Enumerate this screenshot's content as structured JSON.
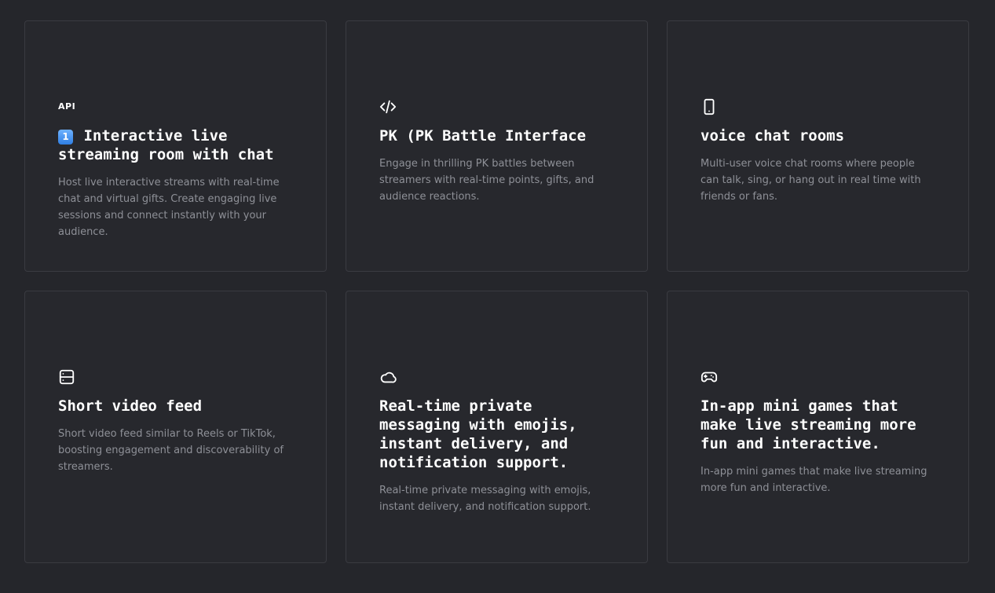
{
  "features": [
    {
      "icon": "api-icon",
      "icon_text": "API",
      "badge": "1",
      "title": "Interactive live streaming room with chat",
      "description": "Host live interactive streams with real-time chat and virtual gifts. Create engaging live sessions and connect instantly with your audience."
    },
    {
      "icon": "code-icon",
      "title": "PK (PK Battle Interface",
      "description": "Engage in thrilling PK battles between streamers with real-time points, gifts, and audience reactions."
    },
    {
      "icon": "smartphone-icon",
      "title": "voice chat rooms",
      "description": "Multi-user voice chat rooms where people can talk, sing, or hang out in real time with friends or fans."
    },
    {
      "icon": "server-icon",
      "title": "Short video feed",
      "description": "Short video feed similar to Reels or TikTok, boosting engagement and discoverability of streamers."
    },
    {
      "icon": "cloud-icon",
      "title": "Real-time private messaging with emojis, instant delivery, and notification support.",
      "description": "Real-time private messaging with emojis, instant delivery, and notification support."
    },
    {
      "icon": "gamepad-icon",
      "title": "In-app mini games that make live streaming more fun and interactive.",
      "description": "In-app mini games that make live streaming more fun and interactive."
    }
  ]
}
